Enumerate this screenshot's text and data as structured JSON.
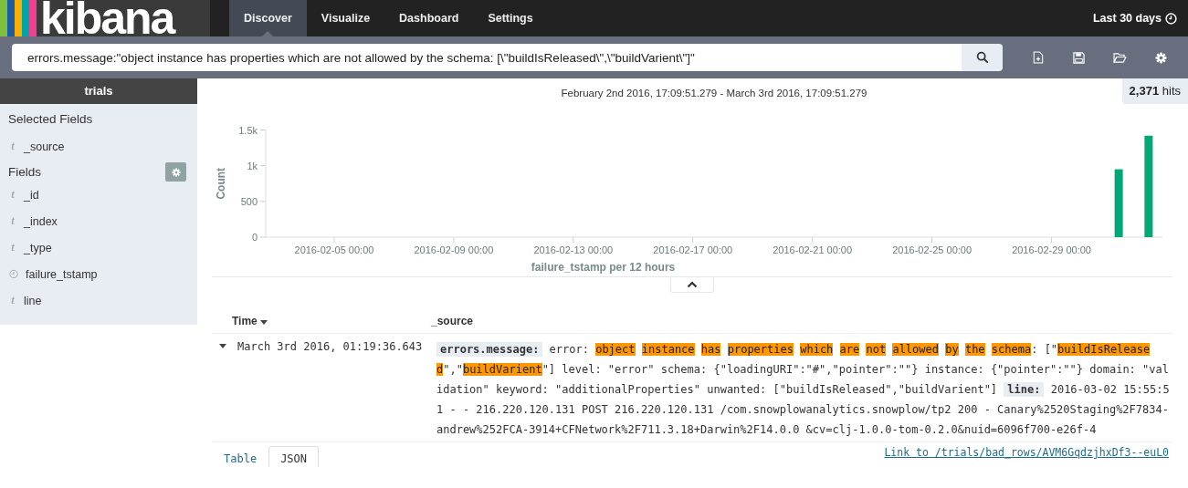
{
  "app": {
    "logo": "kibana"
  },
  "nav_tabs": [
    {
      "label": "Discover",
      "selected": true
    },
    {
      "label": "Visualize",
      "selected": false
    },
    {
      "label": "Dashboard",
      "selected": false
    },
    {
      "label": "Settings",
      "selected": false
    }
  ],
  "time_picker": {
    "label": "Last 30 days"
  },
  "search": {
    "value": "errors.message:\"object instance has properties which are not allowed by the schema: [\\\"buildIsReleased\\\",\\\"buildVarient\\\"]\""
  },
  "sidebar": {
    "index": "trials",
    "selected_fields_title": "Selected Fields",
    "selected_fields": [
      {
        "name": "_source",
        "kind": "string",
        "glyph": "t"
      }
    ],
    "fields_title": "Fields",
    "fields": [
      {
        "name": "_id",
        "kind": "string",
        "glyph": "t"
      },
      {
        "name": "_index",
        "kind": "string",
        "glyph": "t"
      },
      {
        "name": "_type",
        "kind": "string",
        "glyph": "t"
      },
      {
        "name": "failure_tstamp",
        "kind": "date"
      },
      {
        "name": "line",
        "kind": "string",
        "glyph": "t"
      }
    ]
  },
  "hits": "**2,371** hits",
  "chart_data": {
    "type": "bar",
    "title": "February 2nd 2016, 17:09:51.279 - March 3rd 2016, 17:09:51.279",
    "xlabel": "failure_tstamp per 12 hours",
    "ylabel": "Count",
    "categories": [
      null,
      null,
      null,
      null,
      null,
      "2016-02-05 00:00",
      null,
      null,
      null,
      null,
      null,
      null,
      null,
      "2016-02-09 00:00",
      null,
      null,
      null,
      null,
      null,
      null,
      null,
      "2016-02-13 00:00",
      null,
      null,
      null,
      null,
      null,
      null,
      null,
      "2016-02-17 00:00",
      null,
      null,
      null,
      null,
      null,
      null,
      null,
      "2016-02-21 00:00",
      null,
      null,
      null,
      null,
      null,
      null,
      null,
      "2016-02-25 00:00",
      null,
      null,
      null,
      null,
      null,
      null,
      null,
      "2016-02-29 00:00",
      null,
      null,
      null,
      null,
      null,
      null,
      null
    ],
    "series": [
      {
        "color": "#00a878",
        "values": [
          0,
          0,
          0,
          0,
          0,
          0,
          0,
          0,
          0,
          0,
          0,
          0,
          0,
          0,
          0,
          0,
          0,
          0,
          0,
          0,
          0,
          0,
          0,
          0,
          0,
          0,
          0,
          0,
          0,
          0,
          0,
          0,
          0,
          0,
          0,
          0,
          0,
          0,
          0,
          0,
          0,
          0,
          0,
          0,
          0,
          0,
          0,
          0,
          0,
          0,
          0,
          0,
          0,
          0,
          0,
          0,
          0,
          950,
          0,
          1420,
          0
        ]
      }
    ],
    "ylim": [
      0,
      1500
    ],
    "yticks": [
      {
        "value": 0,
        "label": "0"
      },
      {
        "value": 500,
        "label": "500"
      },
      {
        "value": 1000,
        "label": "1k"
      },
      {
        "value": 1500,
        "label": "1.5k"
      }
    ]
  },
  "table": {
    "columns": [
      {
        "label": "Time",
        "sorted": true
      },
      {
        "label": "_source",
        "sorted": false
      }
    ],
    "rows": [
      {
        "expanded": true,
        "time": "March 3rd 2016, 01:19:36.643",
        "source": [
          {
            "kind": "label",
            "text": "errors.message:"
          },
          {
            "kind": "text",
            "text": " error: "
          },
          {
            "kind": "highlight",
            "text": "object instance has properties which are not allowed by the schema"
          },
          {
            "kind": "text",
            "text": ": [\""
          },
          {
            "kind": "highlight",
            "text": "buildIsReleased"
          },
          {
            "kind": "text",
            "text": "\",\""
          },
          {
            "kind": "highlight",
            "text": "buildVarient"
          },
          {
            "kind": "text",
            "text": "\"] level: \"error\" schema: {\"loadingURI\":\"#\",\"pointer\":\"\"} instance: {\"pointer\":\"\"} domain: \"validation\" keyword: \"additionalProperties\" unwanted: [\"buildIsReleased\",\"buildVarient\"] "
          },
          {
            "kind": "label",
            "text": "line:"
          },
          {
            "kind": "text",
            "text": " 2016-03-02 15:55:51 - - 216.220.120.131 POST 216.220.120.131 /com.snowplowanalytics.snowplow/tp2 200 - Canary%2520Staging%2F7834-andrew%252FCA-3914+CFNetwork%2F711.3.18+Darwin%2F14.0.0 &cv=clj-1.0.0-tom-0.2.0&nuid=6096f700-e26f-4"
          }
        ]
      }
    ]
  },
  "doc_tabs": [
    {
      "label": "Table",
      "selected": false
    },
    {
      "label": "JSON",
      "selected": true
    }
  ],
  "doc_link": "Link to /trials/bad_rows/AVM6GqdzjhxDf3--euL0"
}
